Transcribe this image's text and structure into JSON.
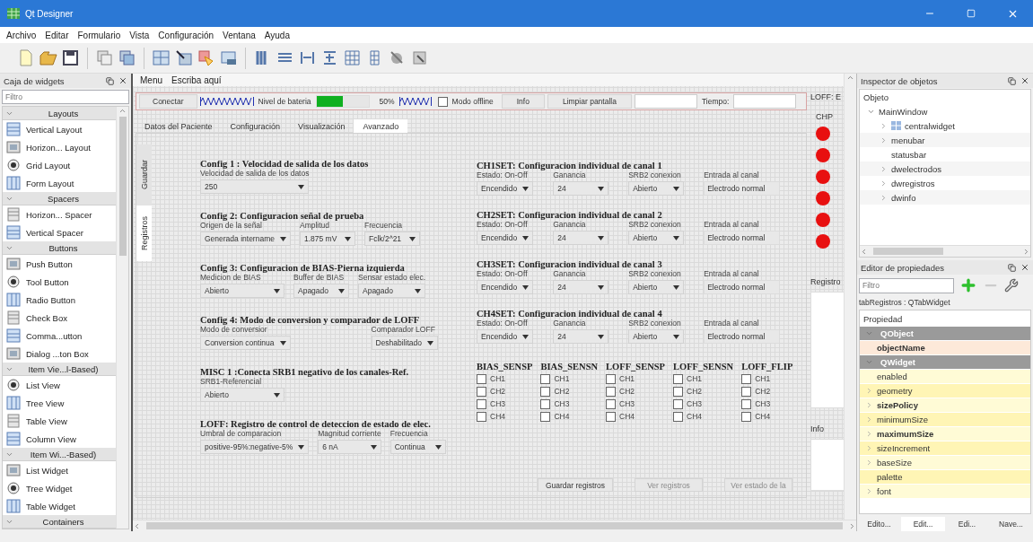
{
  "window": {
    "title": "Qt Designer"
  },
  "menu": [
    "Archivo",
    "Editar",
    "Formulario",
    "Vista",
    "Configuración",
    "Ventana",
    "Ayuda"
  ],
  "widget_box": {
    "title": "Caja de widgets",
    "filter": {
      "placeholder": "Filtro"
    },
    "categories": [
      {
        "label": "Layouts",
        "expanded": true,
        "items": [
          "Vertical Layout",
          "Horizon... Layout",
          "Grid Layout",
          "Form Layout"
        ]
      },
      {
        "label": "Spacers",
        "expanded": true,
        "items": [
          "Horizon... Spacer",
          "Vertical Spacer"
        ]
      },
      {
        "label": "Buttons",
        "expanded": true,
        "items": [
          "Push Button",
          "Tool Button",
          "Radio Button",
          "Check Box",
          "Comma...utton",
          "Dialog ...ton Box"
        ]
      },
      {
        "label": "Item Vie...l-Based)",
        "expanded": true,
        "items": [
          "List View",
          "Tree View",
          "Table View",
          "Column View"
        ]
      },
      {
        "label": "Item Wi...-Based)",
        "expanded": true,
        "items": [
          "List Widget",
          "Tree Widget",
          "Table Widget"
        ]
      },
      {
        "label": "Containers",
        "expanded": true
      }
    ]
  },
  "form": {
    "menubar": [
      "Menu",
      "Escriba aquí"
    ],
    "top_bar": [
      {
        "kind": "button",
        "text": "Conectar"
      },
      {
        "kind": "spacer"
      },
      {
        "kind": "label",
        "text": "Nivel de bateria"
      },
      {
        "kind": "progress",
        "level": 0.5,
        "text": "50%"
      },
      {
        "kind": "spacer"
      },
      {
        "kind": "checkbox",
        "text": "Modo offline",
        "checked": false
      },
      {
        "kind": "button",
        "text": "Info"
      },
      {
        "kind": "button",
        "text": "Limpiar pantalla"
      },
      {
        "kind": "field"
      },
      {
        "kind": "label",
        "text": "Tiempo:"
      },
      {
        "kind": "field"
      }
    ],
    "tabs": [
      {
        "label": "Datos del Paciente",
        "selected": false
      },
      {
        "label": "Configuración",
        "selected": false
      },
      {
        "label": "Visualización",
        "selected": false
      },
      {
        "label": "Avanzado",
        "selected": true
      }
    ],
    "side_tabs": [
      {
        "label": "Guardar",
        "selected": false
      },
      {
        "label": "Registros",
        "selected": true
      }
    ],
    "left_groups": [
      {
        "title": "Config 1 : Velocidad de salida de los datos",
        "fields": [
          {
            "kind": "combo",
            "label": "Velocidad de salida de los datos",
            "value": "250"
          }
        ]
      },
      {
        "title": "Config 2: Configuracion señal de prueba",
        "fields": [
          {
            "kind": "combo",
            "label": "Origen de la señal",
            "value": "Generada intername"
          },
          {
            "kind": "combo",
            "label": "Amplitud",
            "value": "1.875 mV"
          },
          {
            "kind": "combo",
            "label": "Frecuencia",
            "value": "Fclk/2^21"
          }
        ]
      },
      {
        "title": "Config 3: Configuracion de BIAS-Pierna izquierda",
        "fields": [
          {
            "kind": "combo",
            "label": "Medicion de BIAS",
            "value": "Abierto"
          },
          {
            "kind": "combo",
            "label": "Buffer de BIAS",
            "value": "Apagado"
          },
          {
            "kind": "combo",
            "label": "Sensar estado elec.",
            "value": "Apagado"
          }
        ]
      },
      {
        "title": "Config 4: Modo de conversion y comparador de LOFF",
        "fields": [
          {
            "kind": "combo",
            "label": "Modo de conversior",
            "value": "Conversion continua"
          },
          {
            "kind": "combo",
            "label": "Comparador LOFF",
            "value": "Deshabilitado"
          }
        ]
      },
      {
        "title": "MISC 1 :Conecta SRB1 negativo de los canales-Ref.",
        "fields": [
          {
            "kind": "combo",
            "label": "SRB1-Referencial",
            "value": "Abierto"
          }
        ]
      },
      {
        "title": "LOFF: Registro de control de deteccion de estado de elec.",
        "fields": [
          {
            "kind": "combo",
            "label": "Umbral de comparacion",
            "value": "positive-95%:negative-5%"
          },
          {
            "kind": "combo",
            "label": "Magnitud corriente",
            "value": "6 nA"
          },
          {
            "kind": "combo",
            "label": "Frecuencia",
            "value": "Continua"
          }
        ]
      }
    ],
    "right_groups": [
      {
        "title": "CH1SET: Configuracion individual de canal 1",
        "fields": [
          {
            "kind": "combo",
            "label": "Estado: On-Off",
            "value": "Encendido"
          },
          {
            "kind": "combo",
            "label": "Ganancia",
            "value": "24"
          },
          {
            "kind": "combo",
            "label": "SRB2 conexion",
            "value": "Abierto"
          },
          {
            "kind": "display",
            "label": "Entrada al canal",
            "value": "Electrodo normal"
          }
        ]
      },
      {
        "title": "CH2SET: Configuracion individual de canal 2",
        "fields": [
          {
            "kind": "combo",
            "label": "Estado: On-Off",
            "value": "Encendido"
          },
          {
            "kind": "combo",
            "label": "Ganancia",
            "value": "24"
          },
          {
            "kind": "combo",
            "label": "SRB2 conexion",
            "value": "Abierto"
          },
          {
            "kind": "display",
            "label": "Entrada al canal",
            "value": "Electrodo normal"
          }
        ]
      },
      {
        "title": "CH3SET: Configuracion individual de canal 3",
        "fields": [
          {
            "kind": "combo",
            "label": "Estado: On-Off",
            "value": "Encendido"
          },
          {
            "kind": "combo",
            "label": "Ganancia",
            "value": "24"
          },
          {
            "kind": "combo",
            "label": "SRB2 conexion",
            "value": "Abierto"
          },
          {
            "kind": "display",
            "label": "Entrada al canal",
            "value": "Electrodo normal"
          }
        ]
      },
      {
        "title": "CH4SET: Configuracion individual de canal 4",
        "fields": [
          {
            "kind": "combo",
            "label": "Estado: On-Off",
            "value": "Encendido"
          },
          {
            "kind": "combo",
            "label": "Ganancia",
            "value": "24"
          },
          {
            "kind": "combo",
            "label": "SRB2 conexion",
            "value": "Abierto"
          },
          {
            "kind": "display",
            "label": "Entrada al canal",
            "value": "Electrodo normal"
          }
        ]
      }
    ],
    "check_groups": [
      {
        "title": "BIAS_SENSP",
        "items": [
          {
            "label": "CH1",
            "checked": false
          },
          {
            "label": "CH2",
            "checked": false
          },
          {
            "label": "CH3",
            "checked": false
          },
          {
            "label": "CH4",
            "checked": false
          }
        ]
      },
      {
        "title": "BIAS_SENSN",
        "items": [
          {
            "label": "CH1",
            "checked": false
          },
          {
            "label": "CH2",
            "checked": false
          },
          {
            "label": "CH3",
            "checked": false
          },
          {
            "label": "CH4",
            "checked": false
          }
        ]
      },
      {
        "title": "LOFF_SENSP",
        "items": [
          {
            "label": "CH1",
            "checked": false
          },
          {
            "label": "CH2",
            "checked": false
          },
          {
            "label": "CH3",
            "checked": false
          },
          {
            "label": "CH4",
            "checked": false
          }
        ]
      },
      {
        "title": "LOFF_SENSN",
        "items": [
          {
            "label": "CH1",
            "checked": false
          },
          {
            "label": "CH2",
            "checked": false
          },
          {
            "label": "CH3",
            "checked": false
          },
          {
            "label": "CH4",
            "checked": false
          }
        ]
      },
      {
        "title": "LOFF_FLIP",
        "items": [
          {
            "label": "CH1",
            "checked": false
          },
          {
            "label": "CH2",
            "checked": false
          },
          {
            "label": "CH3",
            "checked": false
          },
          {
            "label": "CH4",
            "checked": false
          }
        ]
      }
    ],
    "buttons": [
      {
        "label": "Guardar registros",
        "disabled": false
      },
      {
        "label": "Ver registros",
        "disabled": true
      },
      {
        "label": "Ver estado de la",
        "disabled": true
      }
    ],
    "loff_dock": {
      "title": "LOFF: E",
      "label": "CHP",
      "leds": [
        {
          "on": true
        },
        {
          "on": true
        },
        {
          "on": true
        },
        {
          "on": true
        },
        {
          "on": true
        },
        {
          "on": true
        }
      ]
    },
    "registros_dock": {
      "title": "Registro"
    },
    "info_dock": {
      "title": "Info"
    }
  },
  "object_inspector": {
    "title": "Inspector de objetos",
    "header": "Objeto",
    "tree": [
      {
        "label": "MainWindow",
        "expanded": true,
        "children": [
          {
            "label": "centralwidget",
            "kind": "layout",
            "expandable": true
          },
          {
            "label": "menubar",
            "kind": "object",
            "expandable": true
          },
          {
            "label": "statusbar",
            "kind": "object",
            "expandable": false
          },
          {
            "label": "dwelectrodos",
            "kind": "object",
            "expandable": true
          },
          {
            "label": "dwregistros",
            "kind": "object",
            "expandable": true
          },
          {
            "label": "dwinfo",
            "kind": "object",
            "expandable": true
          }
        ]
      }
    ]
  },
  "property_editor": {
    "title": "Editor de propiedades",
    "filter": {
      "placeholder": "Filtro"
    },
    "object": "tabRegistros : QTabWidget",
    "header": "Propiedad",
    "groups": [
      {
        "name": "QObject",
        "expanded": true,
        "properties": [
          {
            "name": "objectName",
            "changed": true,
            "expandable": false
          }
        ]
      },
      {
        "name": "QWidget",
        "expanded": true,
        "properties": [
          {
            "name": "enabled",
            "changed": false,
            "expandable": false
          },
          {
            "name": "geometry",
            "changed": false,
            "expandable": true
          },
          {
            "name": "sizePolicy",
            "changed": true,
            "expandable": true
          },
          {
            "name": "minimumSize",
            "changed": false,
            "expandable": true
          },
          {
            "name": "maximumSize",
            "changed": true,
            "expandable": true
          },
          {
            "name": "sizeIncrement",
            "changed": false,
            "expandable": true
          },
          {
            "name": "baseSize",
            "changed": false,
            "expandable": true
          },
          {
            "name": "palette",
            "changed": false,
            "expandable": false
          },
          {
            "name": "font",
            "changed": false,
            "expandable": true
          }
        ]
      }
    ]
  },
  "bottom_tabs": [
    {
      "label": "Edito...",
      "selected": false
    },
    {
      "label": "Edit...",
      "selected": true
    },
    {
      "label": "Edi...",
      "selected": false
    },
    {
      "label": "Nave...",
      "selected": false
    }
  ]
}
